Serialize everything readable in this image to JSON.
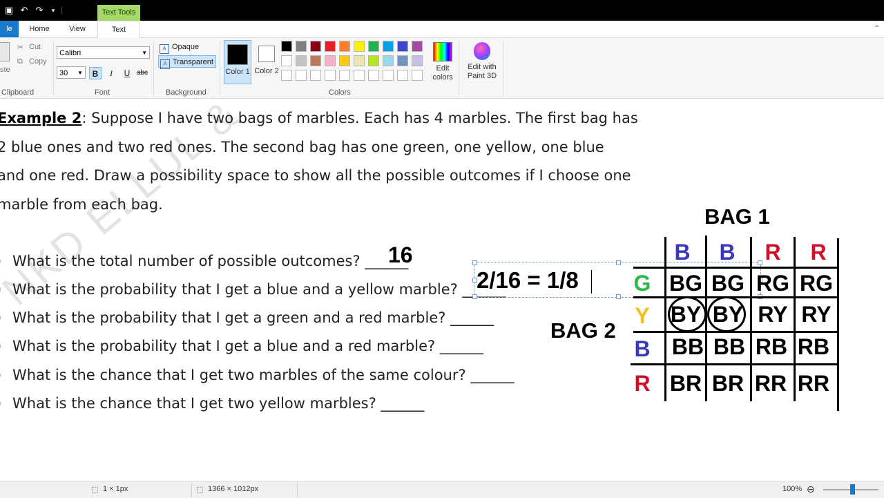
{
  "ribbon": {
    "context_tab": "Text Tools",
    "tabs": [
      {
        "label": "le"
      },
      {
        "label": "Home"
      },
      {
        "label": "View"
      },
      {
        "label": "Text"
      }
    ],
    "clipboard": {
      "cut": "Cut",
      "copy": "Copy",
      "paste": "ste",
      "label": "Clipboard"
    },
    "font": {
      "family": "Calibri",
      "size": "30",
      "bold": "B",
      "italic": "I",
      "underline": "U",
      "strike": "abc",
      "label": "Font"
    },
    "background": {
      "opaque": "Opaque",
      "transparent": "Transparent",
      "label": "Background"
    },
    "colors": {
      "color1": "Color 1",
      "color2": "Color 2",
      "edit": "Edit colors",
      "label": "Colors",
      "color1_value": "#000000",
      "color2_value": "#ffffff",
      "palette_row1": [
        "#000000",
        "#7f7f7f",
        "#880015",
        "#ed1c24",
        "#ff7f27",
        "#fff200",
        "#22b14c",
        "#00a2e8",
        "#3f48cc",
        "#a349a4"
      ],
      "palette_row2": [
        "#ffffff",
        "#c3c3c3",
        "#b97a57",
        "#ffaec9",
        "#ffc90e",
        "#efe4b0",
        "#b5e61d",
        "#99d9ea",
        "#7092be",
        "#c8bfe7"
      ]
    },
    "paint3d": "Edit with Paint 3D"
  },
  "canvas": {
    "watermark": "NKD ELLUL &",
    "example_title": "Example 2",
    "paragraph_lines": [
      ": Suppose I have two bags of marbles. Each has 4 marbles. The first bag has",
      "2 blue ones and two red ones. The second bag has one green, one yellow, one blue",
      "and one red. Draw a possibility space to show all the possible outcomes if I choose one",
      "marble from each bag."
    ],
    "questions": [
      {
        "num": ")",
        "text": "What is the total number of possible outcomes?  ______"
      },
      {
        "num": ")",
        "text": "What is the probability that I get a blue and a yellow marble?  ______"
      },
      {
        "num": ")",
        "text": "What is the probability that I get a green and a red marble? ______"
      },
      {
        "num": ")",
        "text": "What is the probability that I get a blue and a red marble? ______"
      },
      {
        "num": ")",
        "text": "What is the chance that I get two marbles of the same colour? ______"
      },
      {
        "num": ")",
        "text": "What is the chance that I get two yellow marbles? ______"
      }
    ],
    "answer_total": "16",
    "answer_textbox": "2/16 = 1/8",
    "bag1_label": "BAG 1",
    "bag2_label": "BAG 2",
    "bag1_headers": [
      {
        "letter": "B",
        "color": "#3a3ab8"
      },
      {
        "letter": "B",
        "color": "#3a3ab8"
      },
      {
        "letter": "R",
        "color": "#d0102a"
      },
      {
        "letter": "R",
        "color": "#d0102a"
      }
    ],
    "bag2_headers": [
      {
        "letter": "G",
        "color": "#2db84a"
      },
      {
        "letter": "Y",
        "color": "#f0c020"
      },
      {
        "letter": "B",
        "color": "#3a3ab8"
      },
      {
        "letter": "R",
        "color": "#d0102a"
      }
    ],
    "grid": [
      [
        "BG",
        "BG",
        "RG",
        "RG"
      ],
      [
        "BY",
        "BY",
        "RY",
        "RY"
      ],
      [
        "BB",
        "BB",
        "RB",
        "RB"
      ],
      [
        "BR",
        "BR",
        "RR",
        "RR"
      ]
    ]
  },
  "status": {
    "selection": "1 × 1px",
    "size": "1366 × 1012px",
    "zoom": "100%",
    "zoom_out": "⊖"
  }
}
